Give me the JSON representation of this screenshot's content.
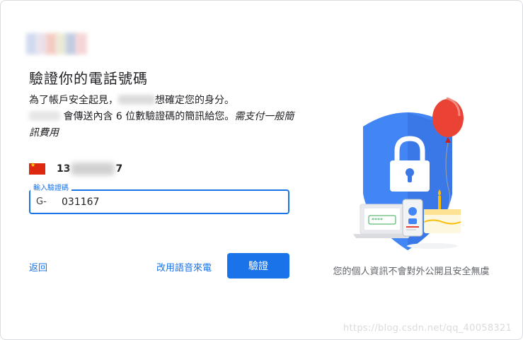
{
  "title": "驗證你的電話號碼",
  "description": {
    "line1_prefix": "為了帳戶安全起見，",
    "line1_suffix": "想確定您的身分。",
    "line2": "會傳送內含 6 位數驗證碼的簡訊給您。",
    "fee_note": "需支付一般簡訊費用"
  },
  "phone": {
    "prefix": "13",
    "suffix": "7"
  },
  "code_field": {
    "label": "輸入驗證碼",
    "prefix": "G-",
    "value": "031167"
  },
  "actions": {
    "back": "返回",
    "voice": "改用語音來電",
    "verify": "驗證"
  },
  "caption": "您的個人資訊不會對外公開且安全無虞",
  "watermark": "https://blog.csdn.net/qq_40058321",
  "colors": {
    "accent": "#1a73e8",
    "shield": "#4285f4",
    "balloon": "#ea4335"
  }
}
